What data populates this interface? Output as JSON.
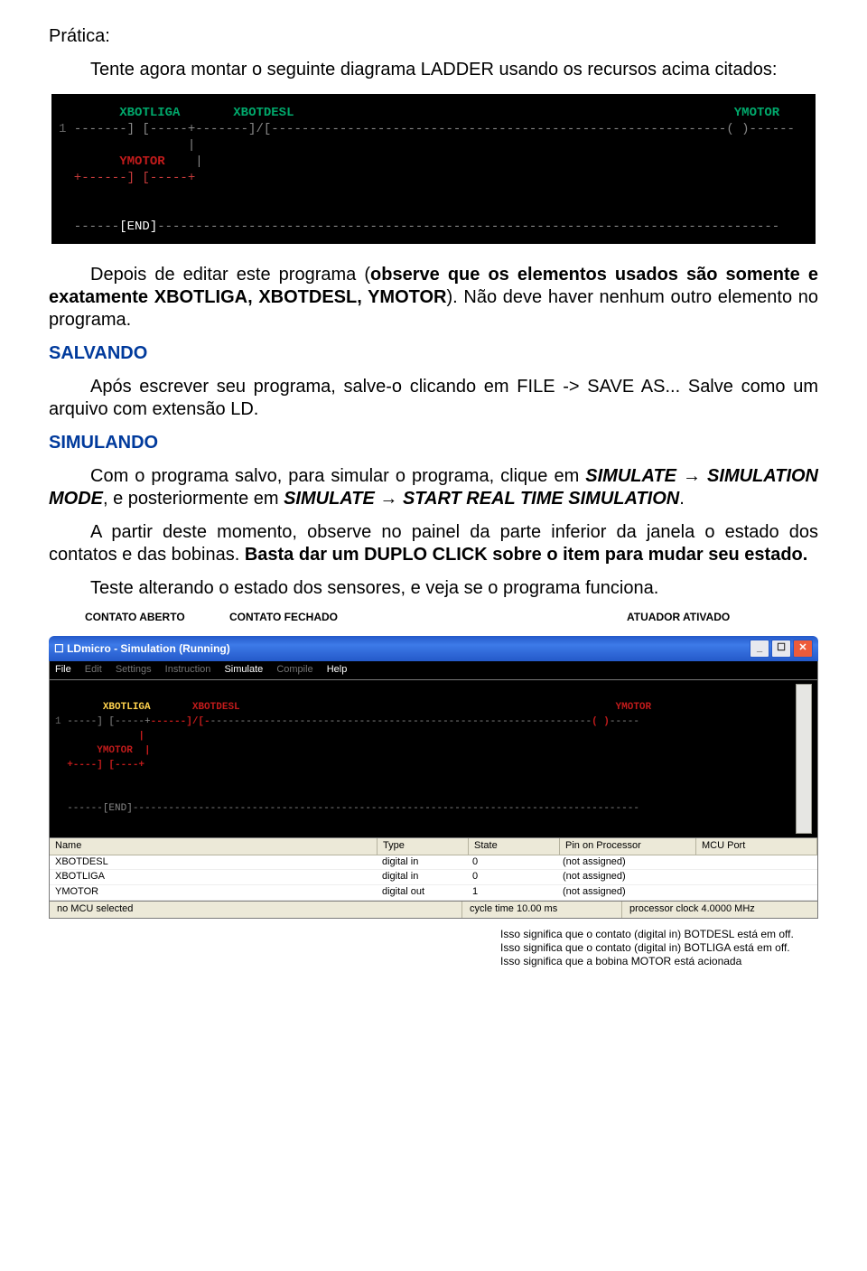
{
  "doc": {
    "heading_pratica": "Prática:",
    "p1": "Tente agora montar o seguinte diagrama LADDER usando os recursos acima citados:",
    "p2_pre": "Depois de editar este programa (",
    "p2_bold": "observe que os elementos usados são somente e exatamente XBOTLIGA, XBOTDESL, YMOTOR",
    "p2_post": "). Não deve haver nenhum outro elemento no programa.",
    "h_salvando": "SALVANDO",
    "p3": "Após escrever seu programa, salve-o clicando em FILE -> SAVE AS... Salve como um arquivo com extensão LD.",
    "h_simulando": "SIMULANDO",
    "p4_a": "Com o programa salvo, para simular o programa, clique em ",
    "p4_b": "SIMULATE → SIMULATION MODE",
    "p4_c": ", e posteriormente em ",
    "p4_d": "SIMULATE → START REAL TIME SIMULATION",
    "p4_e": ".",
    "p5": "A partir deste momento, observe no painel da parte inferior da janela o estado dos contatos e das bobinas. ",
    "p5_bold": "Basta dar um DUPLO CLICK sobre o item para mudar seu estado.",
    "p6": "Teste alterando o estado dos sensores, e veja se o programa funciona."
  },
  "ladder1": {
    "xbotliga": "XBOTLIGA",
    "xbotdesl": "XBOTDESL",
    "ymotor": "YMOTOR",
    "ymotor_branch": "YMOTOR",
    "end": "[END]"
  },
  "sim_labels": {
    "open": "CONTATO ABERTO",
    "closed": "CONTATO FECHADO",
    "actuator": "ATUADOR ATIVADO"
  },
  "window": {
    "title": "LDmicro - Simulation (Running)",
    "menu": {
      "file": "File",
      "edit": "Edit",
      "settings": "Settings",
      "instruction": "Instruction",
      "simulate": "Simulate",
      "compile": "Compile",
      "help": "Help"
    }
  },
  "simladder": {
    "xbotliga": "XBOTLIGA",
    "xbotdesl": "XBOTDESL",
    "ymotor": "YMOTOR",
    "ymotor_branch": "YMOTOR",
    "end": "[END]"
  },
  "iotable": {
    "headers": {
      "name": "Name",
      "type": "Type",
      "state": "State",
      "pin": "Pin on Processor",
      "port": "MCU Port"
    },
    "rows": [
      {
        "name": "XBOTDESL",
        "type": "digital in",
        "state": "0",
        "pin": "(not assigned)",
        "port": ""
      },
      {
        "name": "XBOTLIGA",
        "type": "digital in",
        "state": "0",
        "pin": "(not assigned)",
        "port": ""
      },
      {
        "name": "YMOTOR",
        "type": "digital out",
        "state": "1",
        "pin": "(not assigned)",
        "port": ""
      }
    ]
  },
  "statusbar": {
    "mcu": "no MCU selected",
    "cycle": "cycle time 10.00 ms",
    "clock": "processor clock 4.0000 MHz"
  },
  "footnotes": {
    "l1": "Isso significa que o contato (digital in) BOTDESL está em off.",
    "l2": "Isso significa que o contato (digital in) BOTLIGA está em off.",
    "l3": "Isso significa que a bobina MOTOR está acionada"
  }
}
